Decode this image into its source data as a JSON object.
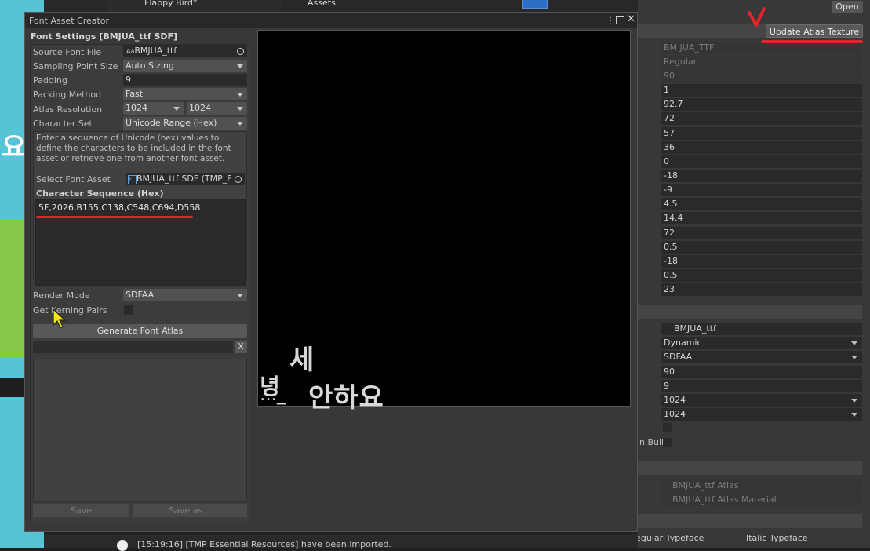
{
  "background": {
    "hierarchy_item": "Flappy Bird*",
    "assets_label": "Assets",
    "side_glyph": "요",
    "open_button": "Open",
    "update_atlas_button": "Update Atlas Texture",
    "inspector_values": [
      "BM JUA_TTF",
      "Regular",
      "90",
      "1",
      "92.7",
      "72",
      "57",
      "36",
      "0",
      "-18",
      "-9",
      "4.5",
      "14.4",
      "72",
      "0.5",
      "-18",
      "0.5",
      "23"
    ],
    "inspector_settings": {
      "source_font": "BMJUA_ttf",
      "population_mode": "Dynamic",
      "render_mode": "SDFAA",
      "sampling_point_size": "90",
      "padding": "9",
      "atlas_width": "1024",
      "atlas_height": "1024",
      "clear_build_label": "n Build",
      "atlas_texture": "BMJUA_ttf Atlas",
      "atlas_material": "BMJUA_ttf Atlas Material"
    },
    "footer_left": "Regular Typeface",
    "footer_right": "Italic Typeface",
    "console_message": "[15:19:16] [TMP Essential Resources] have been imported."
  },
  "window": {
    "title": "Font Asset Creator",
    "section_header": "Font Settings [BMJUA_ttf SDF]",
    "labels": {
      "source_font_file": "Source Font File",
      "sampling_point_size": "Sampling Point Size",
      "padding": "Padding",
      "packing_method": "Packing Method",
      "atlas_resolution": "Atlas Resolution",
      "character_set": "Character Set",
      "select_font_asset": "Select Font Asset",
      "character_sequence": "Character Sequence (Hex)",
      "render_mode": "Render Mode",
      "get_kerning_pairs": "Get Kerning Pairs"
    },
    "values": {
      "source_font_file": "BMJUA_ttf",
      "sampling_point_size": "Auto Sizing",
      "padding": "9",
      "packing_method": "Fast",
      "atlas_width": "1024",
      "atlas_height": "1024",
      "character_set": "Unicode Range (Hex)",
      "select_font_asset": "BMJUA_ttf SDF (TMP_F",
      "character_sequence": "5F,2026,B155,C138,C548,C694,D558",
      "render_mode": "SDFAA"
    },
    "help_text": "Enter a sequence of Unicode (hex) values to define the characters to be included in the font asset or retrieve one from another font asset.",
    "generate_button": "Generate Font Atlas",
    "clear_button": "X",
    "save_button": "Save",
    "save_as_button": "Save as...",
    "atlas_glyphs": {
      "g1": "세",
      "g2": "녕",
      "g3": "…_",
      "g4": "안하요"
    }
  },
  "colors": {
    "annotation_red": "#e0242a",
    "panel": "#383838",
    "field": "#2a2a2a"
  }
}
